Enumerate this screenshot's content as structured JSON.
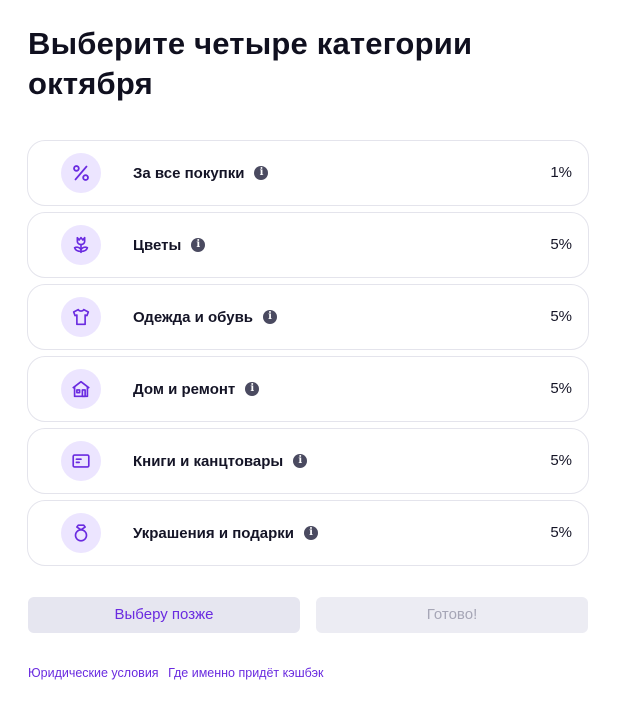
{
  "title": "Выберите четыре категории октября",
  "categories": [
    {
      "label": "За все покупки",
      "percent": "1%",
      "icon": "percent-icon"
    },
    {
      "label": "Цветы",
      "percent": "5%",
      "icon": "flower-icon"
    },
    {
      "label": "Одежда и обувь",
      "percent": "5%",
      "icon": "tshirt-icon"
    },
    {
      "label": "Дом и ремонт",
      "percent": "5%",
      "icon": "house-icon"
    },
    {
      "label": "Книги и канцтовары",
      "percent": "5%",
      "icon": "book-icon"
    },
    {
      "label": "Украшения и подарки",
      "percent": "5%",
      "icon": "ring-icon"
    }
  ],
  "info_glyph": "i",
  "buttons": {
    "later": "Выберу позже",
    "done": "Готово!"
  },
  "footer": {
    "legal": "Юридические условия",
    "where": "Где именно придёт кэшбэк"
  },
  "colors": {
    "accent": "#6a2be0",
    "icon_bg": "#ece5ff",
    "border": "#e4e4ec",
    "button_bg": "#e6e6f0"
  }
}
